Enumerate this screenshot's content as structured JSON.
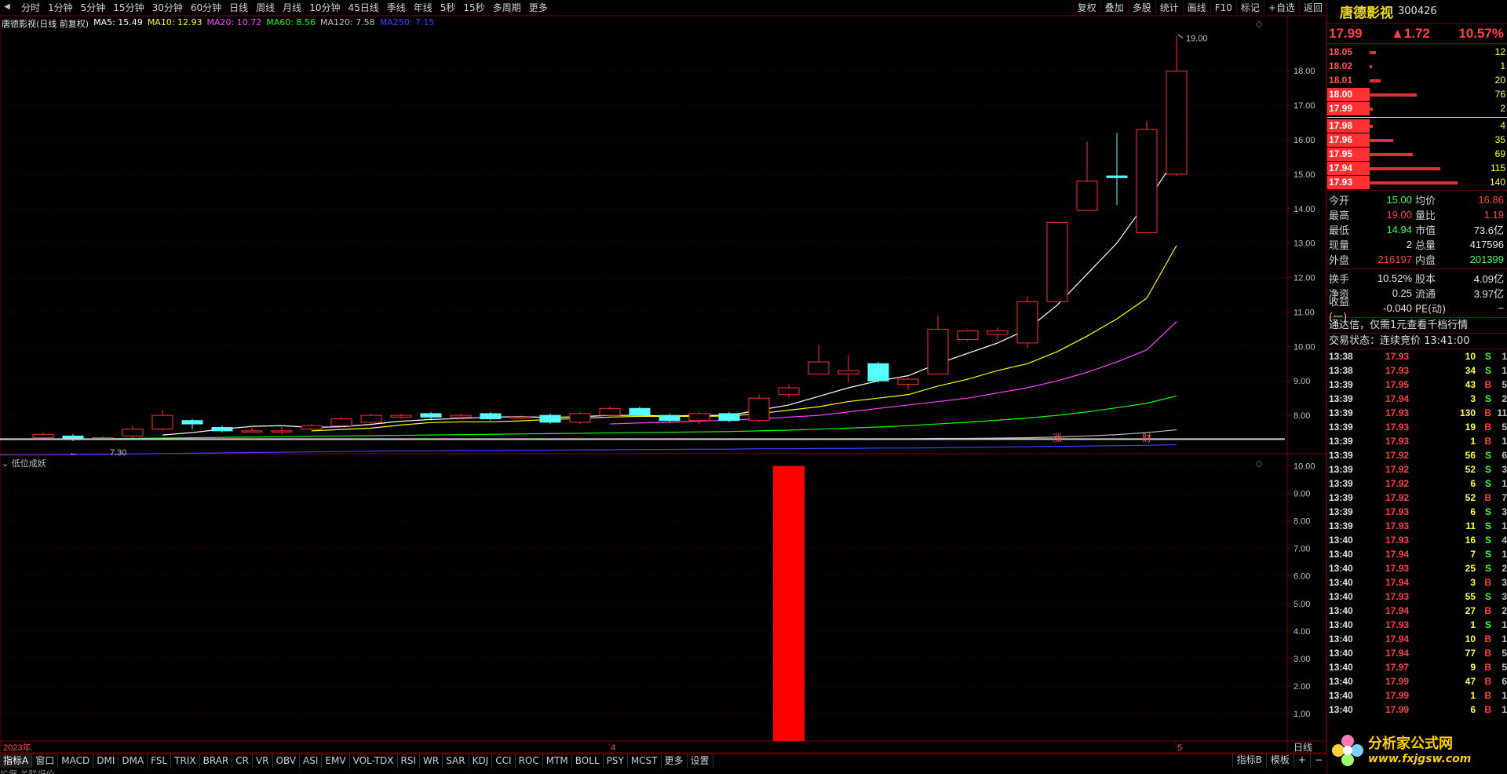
{
  "toolbar": {
    "periods": [
      "分时",
      "1分钟",
      "5分钟",
      "15分钟",
      "30分钟",
      "60分钟",
      "日线",
      "周线",
      "月线",
      "10分钟",
      "45日线",
      "季线",
      "年线",
      "5秒",
      "15秒",
      "多周期",
      "更多"
    ],
    "right_buttons": [
      "复权",
      "叠加",
      "多股",
      "统计",
      "画线",
      "F10",
      "标记",
      "+自选",
      "返回"
    ]
  },
  "legend": {
    "name": "唐德影视(日线 前复权)",
    "ma5": "MA5: 15.49",
    "ma10": "MA10: 12.93",
    "ma20": "MA20: 10.72",
    "ma60": "MA60: 8.56",
    "ma120": "MA120: 7.58",
    "ma250": "MA250: 7.15",
    "colors": {
      "ma5": "#ffffff",
      "ma10": "#ffff00",
      "ma20": "#ff40ff",
      "ma60": "#00ff00",
      "ma120": "#c0c0c0",
      "ma250": "#4040ff"
    }
  },
  "sub_indicator": {
    "name": "低位成妖"
  },
  "chart_data": [
    {
      "type": "candlestick",
      "title": "唐德影视(日线 前复权)",
      "y_ticks": [
        "18.00",
        "17.00",
        "16.00",
        "15.00",
        "14.00",
        "13.00",
        "12.00",
        "11.00",
        "10.00",
        "9.00",
        "8.00"
      ],
      "ylim": [
        7.0,
        19.6
      ],
      "high_label": "19.00",
      "low_label": "7.30",
      "candles": [
        {
          "o": 7.35,
          "c": 7.45,
          "h": 7.5,
          "l": 7.3
        },
        {
          "o": 7.4,
          "c": 7.3,
          "h": 7.45,
          "l": 7.25
        },
        {
          "o": 7.35,
          "c": 7.35,
          "h": 7.4,
          "l": 7.3
        },
        {
          "o": 7.4,
          "c": 7.6,
          "h": 7.7,
          "l": 7.35
        },
        {
          "o": 7.6,
          "c": 8.0,
          "h": 8.15,
          "l": 7.55
        },
        {
          "o": 7.85,
          "c": 7.75,
          "h": 7.9,
          "l": 7.6
        },
        {
          "o": 7.65,
          "c": 7.55,
          "h": 7.7,
          "l": 7.5
        },
        {
          "o": 7.55,
          "c": 7.55,
          "h": 7.7,
          "l": 7.5
        },
        {
          "o": 7.55,
          "c": 7.55,
          "h": 7.7,
          "l": 7.45
        },
        {
          "o": 7.6,
          "c": 7.7,
          "h": 7.75,
          "l": 7.55
        },
        {
          "o": 7.7,
          "c": 7.9,
          "h": 7.95,
          "l": 7.65
        },
        {
          "o": 7.8,
          "c": 8.0,
          "h": 8.05,
          "l": 7.75
        },
        {
          "o": 7.95,
          "c": 8.0,
          "h": 8.05,
          "l": 7.9
        },
        {
          "o": 8.05,
          "c": 7.95,
          "h": 8.1,
          "l": 7.85
        },
        {
          "o": 7.95,
          "c": 8.0,
          "h": 8.05,
          "l": 7.9
        },
        {
          "o": 8.05,
          "c": 7.9,
          "h": 8.1,
          "l": 7.85
        },
        {
          "o": 7.95,
          "c": 7.95,
          "h": 8.0,
          "l": 7.9
        },
        {
          "o": 8.0,
          "c": 7.8,
          "h": 8.05,
          "l": 7.75
        },
        {
          "o": 7.8,
          "c": 8.05,
          "h": 8.1,
          "l": 7.75
        },
        {
          "o": 8.0,
          "c": 8.2,
          "h": 8.25,
          "l": 7.95
        },
        {
          "o": 8.2,
          "c": 8.0,
          "h": 8.25,
          "l": 7.95
        },
        {
          "o": 8.0,
          "c": 7.85,
          "h": 8.05,
          "l": 7.8
        },
        {
          "o": 7.85,
          "c": 8.05,
          "h": 8.1,
          "l": 7.75
        },
        {
          "o": 8.05,
          "c": 7.85,
          "h": 8.1,
          "l": 7.8
        },
        {
          "o": 7.85,
          "c": 8.5,
          "h": 8.6,
          "l": 7.8
        },
        {
          "o": 8.6,
          "c": 8.8,
          "h": 8.9,
          "l": 8.5
        },
        {
          "o": 9.2,
          "c": 9.55,
          "h": 10.05,
          "l": 9.2
        },
        {
          "o": 9.2,
          "c": 9.3,
          "h": 9.75,
          "l": 8.95
        },
        {
          "o": 9.5,
          "c": 9.0,
          "h": 9.55,
          "l": 8.95
        },
        {
          "o": 8.9,
          "c": 9.05,
          "h": 9.1,
          "l": 8.75
        },
        {
          "o": 9.2,
          "c": 10.5,
          "h": 10.9,
          "l": 9.2
        },
        {
          "o": 10.2,
          "c": 10.45,
          "h": 10.5,
          "l": 10.15
        },
        {
          "o": 10.35,
          "c": 10.45,
          "h": 10.55,
          "l": 10.15
        },
        {
          "o": 10.1,
          "c": 11.3,
          "h": 11.45,
          "l": 9.95
        },
        {
          "o": 11.3,
          "c": 13.6,
          "h": 13.6,
          "l": 11.3
        },
        {
          "o": 13.95,
          "c": 14.8,
          "h": 15.95,
          "l": 13.95
        },
        {
          "o": 14.95,
          "c": 14.9,
          "h": 16.2,
          "l": 14.1
        },
        {
          "o": 13.3,
          "c": 16.3,
          "h": 16.55,
          "l": 13.3
        },
        {
          "o": 15.0,
          "c": 17.99,
          "h": 19.0,
          "l": 14.94
        }
      ],
      "series": [
        {
          "name": "MA5",
          "values": [
            null,
            null,
            null,
            null,
            7.43,
            7.5,
            7.6,
            7.68,
            7.7,
            7.65,
            7.67,
            7.74,
            7.83,
            7.88,
            7.91,
            7.95,
            7.96,
            7.94,
            7.96,
            8.0,
            8.0,
            7.98,
            8.0,
            8.0,
            8.15,
            8.3,
            8.55,
            8.8,
            9.0,
            9.15,
            9.5,
            9.8,
            10.1,
            10.5,
            11.2,
            12.1,
            13.0,
            14.2,
            15.49
          ]
        },
        {
          "name": "MA10",
          "values": [
            null,
            null,
            null,
            null,
            null,
            null,
            null,
            null,
            null,
            7.55,
            7.59,
            7.63,
            7.72,
            7.79,
            7.81,
            7.81,
            7.84,
            7.88,
            7.91,
            7.95,
            7.97,
            7.97,
            7.97,
            7.98,
            8.05,
            8.15,
            8.25,
            8.4,
            8.5,
            8.6,
            8.85,
            9.05,
            9.3,
            9.5,
            9.85,
            10.3,
            10.8,
            11.4,
            12.93
          ]
        },
        {
          "name": "MA20",
          "values": [
            null,
            null,
            null,
            null,
            null,
            null,
            null,
            null,
            null,
            null,
            null,
            null,
            null,
            null,
            null,
            null,
            null,
            null,
            null,
            7.75,
            7.78,
            7.8,
            7.83,
            7.86,
            7.9,
            7.95,
            8.0,
            8.1,
            8.2,
            8.3,
            8.4,
            8.5,
            8.65,
            8.8,
            9.0,
            9.25,
            9.55,
            9.9,
            10.72
          ]
        },
        {
          "name": "MA60",
          "values": [
            7.3,
            7.31,
            7.32,
            7.33,
            7.34,
            7.35,
            7.36,
            7.37,
            7.38,
            7.39,
            7.4,
            7.41,
            7.42,
            7.43,
            7.44,
            7.45,
            7.46,
            7.47,
            7.48,
            7.49,
            7.5,
            7.51,
            7.52,
            7.53,
            7.55,
            7.57,
            7.6,
            7.63,
            7.66,
            7.7,
            7.75,
            7.8,
            7.86,
            7.92,
            8.0,
            8.1,
            8.22,
            8.35,
            8.56
          ]
        },
        {
          "name": "MA120",
          "values": [
            7.3,
            7.3,
            7.3,
            7.3,
            7.3,
            7.3,
            7.3,
            7.3,
            7.3,
            7.3,
            7.3,
            7.3,
            7.3,
            7.3,
            7.3,
            7.3,
            7.3,
            7.3,
            7.3,
            7.31,
            7.31,
            7.31,
            7.31,
            7.31,
            7.31,
            7.31,
            7.31,
            7.32,
            7.32,
            7.32,
            7.33,
            7.33,
            7.34,
            7.35,
            7.37,
            7.4,
            7.44,
            7.5,
            7.58
          ]
        },
        {
          "name": "MA250",
          "values": [
            6.85,
            6.86,
            6.87,
            6.88,
            6.89,
            6.9,
            6.91,
            6.92,
            6.93,
            6.94,
            6.95,
            6.96,
            6.97,
            6.97,
            6.98,
            6.98,
            6.99,
            6.99,
            7.0,
            7.0,
            7.01,
            7.01,
            7.02,
            7.02,
            7.03,
            7.03,
            7.04,
            7.04,
            7.05,
            7.05,
            7.06,
            7.07,
            7.08,
            7.09,
            7.1,
            7.11,
            7.12,
            7.13,
            7.15
          ]
        }
      ],
      "markers": [
        {
          "index": 34,
          "text": "涨"
        },
        {
          "index": 37,
          "text": "财"
        }
      ]
    },
    {
      "type": "bar",
      "title": "低位成妖",
      "y_ticks": [
        "10.00",
        "9.00",
        "8.00",
        "7.00",
        "6.00",
        "5.00",
        "4.00",
        "3.00",
        "2.00",
        "1.00"
      ],
      "ylim": [
        0,
        10.3
      ],
      "bars": [
        {
          "index": 25,
          "value": 10
        }
      ]
    }
  ],
  "x_axis": {
    "labels": [
      "2023年",
      "4",
      "5"
    ],
    "period": "日线"
  },
  "bottom_tabs": [
    "指标A",
    "窗口",
    "MACD",
    "DMI",
    "DMA",
    "FSL",
    "TRIX",
    "BRAR",
    "CR",
    "VR",
    "OBV",
    "ASI",
    "EMV",
    "VOL-TDX",
    "RSI",
    "WR",
    "SAR",
    "KDJ",
    "CCI",
    "ROC",
    "MTM",
    "BOLL",
    "PSY",
    "MCST",
    "更多",
    "设置"
  ],
  "bottom_right_tabs": [
    "指标B",
    "模板",
    "+",
    "−"
  ],
  "status_strip": "扩展  关联报价",
  "quote": {
    "name": "唐德影视",
    "code": "300426",
    "price": "17.99",
    "change": "▲1.72",
    "change_pct": "10.57%",
    "asks": [
      {
        "price": "18.05",
        "vol": "12",
        "bar": 8
      },
      {
        "price": "18.02",
        "vol": "1",
        "bar": 3
      },
      {
        "price": "18.01",
        "vol": "20",
        "bar": 14
      },
      {
        "price": "18.00",
        "vol": "76",
        "bar": 60
      },
      {
        "price": "17.99",
        "vol": "2",
        "bar": 4
      }
    ],
    "bids": [
      {
        "price": "17.98",
        "vol": "4",
        "bar": 4
      },
      {
        "price": "17.96",
        "vol": "35",
        "bar": 30
      },
      {
        "price": "17.95",
        "vol": "69",
        "bar": 55
      },
      {
        "price": "17.94",
        "vol": "115",
        "bar": 90
      },
      {
        "price": "17.93",
        "vol": "140",
        "bar": 112
      }
    ],
    "stats1": [
      {
        "k1": "今开",
        "v1": "15.00",
        "c1": "green",
        "k2": "均价",
        "v2": "16.86",
        "c2": "red"
      },
      {
        "k1": "最高",
        "v1": "19.00",
        "c1": "red",
        "k2": "量比",
        "v2": "1.19",
        "c2": "red"
      },
      {
        "k1": "最低",
        "v1": "14.94",
        "c1": "green",
        "k2": "市值",
        "v2": "73.6亿",
        "c2": "white"
      },
      {
        "k1": "现量",
        "v1": "2",
        "c1": "white",
        "k2": "总量",
        "v2": "417596",
        "c2": "white"
      },
      {
        "k1": "外盘",
        "v1": "216197",
        "c1": "red",
        "k2": "内盘",
        "v2": "201399",
        "c2": "green"
      }
    ],
    "stats2": [
      {
        "k1": "换手",
        "v1": "10.52%",
        "c1": "white",
        "k2": "股本",
        "v2": "4.09亿",
        "c2": "white"
      },
      {
        "k1": "净资",
        "v1": "0.25",
        "c1": "white",
        "k2": "流通",
        "v2": "3.97亿",
        "c2": "white"
      },
      {
        "k1": "收益(一)",
        "v1": "-0.040",
        "c1": "white",
        "k2": "PE(动)",
        "v2": "−",
        "c2": "white"
      }
    ],
    "notice": "通达信，仅需1元查看千档行情",
    "trade_state": "交易状态：连续竞价 13:41:00",
    "ticks": [
      [
        "13:38",
        "17.93",
        "10",
        "S",
        "1"
      ],
      [
        "13:38",
        "17.93",
        "34",
        "S",
        "1"
      ],
      [
        "13:39",
        "17.95",
        "43",
        "B",
        "5"
      ],
      [
        "13:39",
        "17.94",
        "3",
        "S",
        "2"
      ],
      [
        "13:39",
        "17.93",
        "130",
        "B",
        "11"
      ],
      [
        "13:39",
        "17.93",
        "19",
        "B",
        "5"
      ],
      [
        "13:39",
        "17.93",
        "1",
        "B",
        "1"
      ],
      [
        "13:39",
        "17.92",
        "56",
        "S",
        "6"
      ],
      [
        "13:39",
        "17.92",
        "52",
        "S",
        "3"
      ],
      [
        "13:39",
        "17.92",
        "6",
        "S",
        "1"
      ],
      [
        "13:39",
        "17.92",
        "52",
        "B",
        "7"
      ],
      [
        "13:39",
        "17.93",
        "6",
        "S",
        "3"
      ],
      [
        "13:39",
        "17.93",
        "11",
        "S",
        "1"
      ],
      [
        "13:40",
        "17.93",
        "16",
        "S",
        "4"
      ],
      [
        "13:40",
        "17.94",
        "7",
        "S",
        "1"
      ],
      [
        "13:40",
        "17.93",
        "25",
        "S",
        "2"
      ],
      [
        "13:40",
        "17.94",
        "3",
        "B",
        "3"
      ],
      [
        "13:40",
        "17.93",
        "55",
        "S",
        "3"
      ],
      [
        "13:40",
        "17.94",
        "27",
        "B",
        "2"
      ],
      [
        "13:40",
        "17.93",
        "1",
        "S",
        "1"
      ],
      [
        "13:40",
        "17.94",
        "10",
        "B",
        "1"
      ],
      [
        "13:40",
        "17.94",
        "77",
        "B",
        "5"
      ],
      [
        "13:40",
        "17.97",
        "9",
        "B",
        "5"
      ],
      [
        "13:40",
        "17.99",
        "47",
        "B",
        "6"
      ],
      [
        "13:40",
        "17.99",
        "1",
        "B",
        "1"
      ],
      [
        "13:40",
        "17.99",
        "6",
        "B",
        "1"
      ]
    ]
  },
  "watermark": {
    "text": "分析家公式网",
    "url": "www.fxjgsw.com"
  }
}
